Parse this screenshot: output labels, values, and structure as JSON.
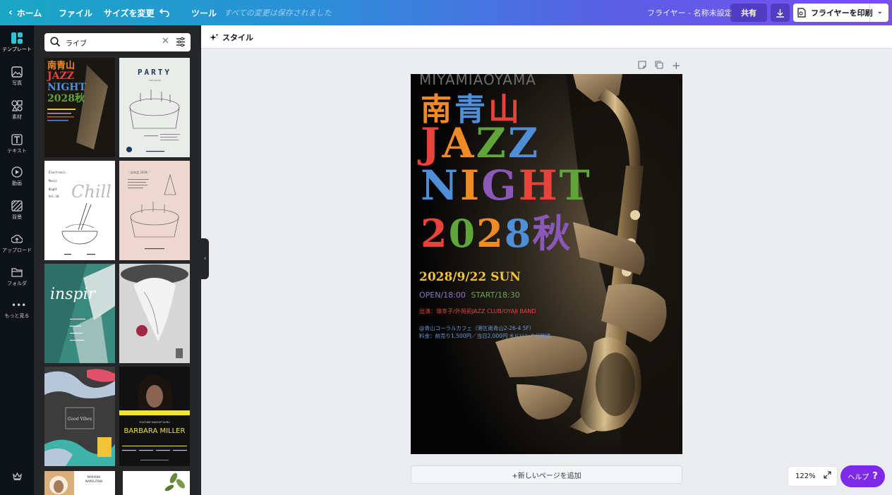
{
  "topbar": {
    "home": "ホーム",
    "file": "ファイル",
    "resize": "サイズを変更",
    "tools": "ツール",
    "saved_status": "すべての変更は保存されました",
    "doc_title": "フライヤー - 名称未設定",
    "share": "共有",
    "print": "フライヤーを印刷"
  },
  "rail": {
    "items": [
      {
        "label": "テンプレート",
        "icon": "templates-icon"
      },
      {
        "label": "写真",
        "icon": "photo-icon"
      },
      {
        "label": "素材",
        "icon": "elements-icon"
      },
      {
        "label": "テキスト",
        "icon": "text-icon"
      },
      {
        "label": "動画",
        "icon": "video-icon"
      },
      {
        "label": "背景",
        "icon": "background-icon"
      },
      {
        "label": "アップロード",
        "icon": "upload-icon"
      },
      {
        "label": "フォルダ",
        "icon": "folder-icon"
      },
      {
        "label": "もっと見る",
        "icon": "more-icon"
      }
    ]
  },
  "search": {
    "value": "ライブ"
  },
  "toolbar": {
    "style": "スタイル"
  },
  "templates": [
    {
      "name": "jazz-night"
    },
    {
      "name": "party"
    },
    {
      "name": "chill"
    },
    {
      "name": "party-pink"
    },
    {
      "name": "inspire"
    },
    {
      "name": "white-flower"
    },
    {
      "name": "good-vibes"
    },
    {
      "name": "barbara-miller",
      "text": "BARBARA MILLER",
      "sub": "YOUTUBE MAKEUP GURU"
    },
    {
      "name": "mariana",
      "text": "MARIANA NAPOLITANI"
    },
    {
      "name": "leaves"
    }
  ],
  "poster": {
    "top_text": "MIYAMIAOYAMA",
    "line1": [
      "南",
      "青",
      "山"
    ],
    "line2": [
      "J",
      "A",
      "Z",
      "Z"
    ],
    "line3": [
      "N",
      "I",
      "G",
      "H",
      "T"
    ],
    "line4": [
      "2",
      "0",
      "2",
      "8",
      "秋"
    ],
    "date": "2028/9/22 SUN",
    "open": "OPEN/18:00",
    "start": "START/18:30",
    "performers": "出演：嶺幸子/外苑前JAZZ CLUB/OYAJI BAND",
    "venue": "@青山コーラルカフェ（港区南青山2-26-4 5F）",
    "fee": "料金：前売り1,500円／当日2,000円 ※ドリンク代別途",
    "colors": {
      "orange": "#f08a24",
      "blue": "#4f8fd8",
      "red": "#e8423a",
      "green": "#5fa53a",
      "purple": "#8a58b8",
      "yellow": "#f2c438"
    }
  },
  "add_page": "+新しいページを追加",
  "zoom": "122%",
  "help": "ヘルプ",
  "help_q": "?"
}
